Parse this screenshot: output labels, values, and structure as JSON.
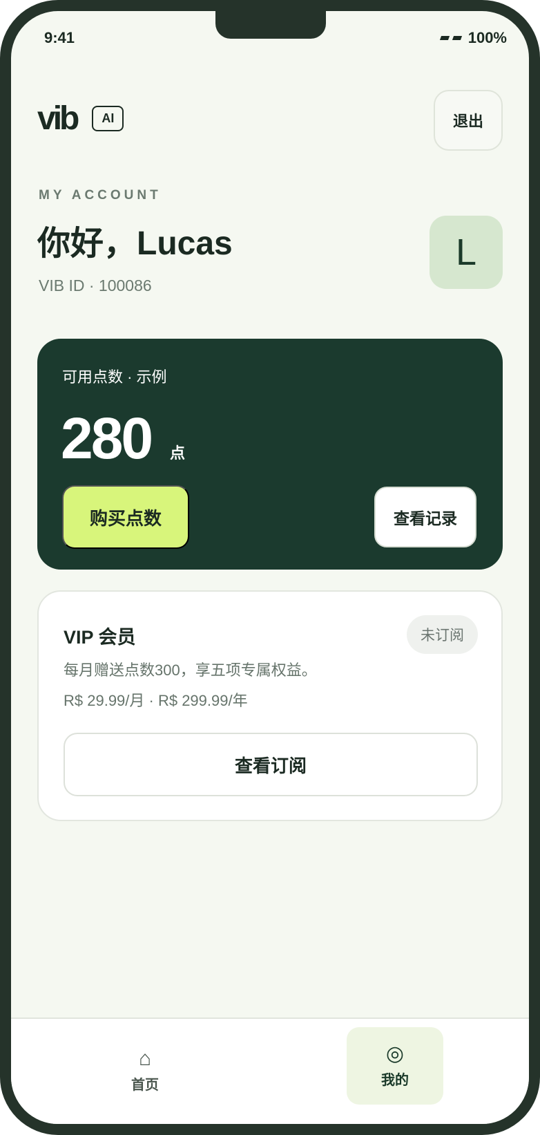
{
  "status_bar": {
    "time": "9:41",
    "battery": "100%"
  },
  "header": {
    "logo": "vib",
    "ai_badge": "AI",
    "logout_label": "退出"
  },
  "account": {
    "eyebrow": "MY ACCOUNT",
    "greeting": "你好，Lucas",
    "vib_id": "VIB ID · 100086",
    "avatar_initial": "L"
  },
  "points_card": {
    "label": "可用点数 · 示例",
    "value": "280",
    "unit": "点",
    "buy_label": "购买点数",
    "history_label": "查看记录"
  },
  "vip_card": {
    "title": "VIP 会员",
    "status": "未订阅",
    "description": "每月赠送点数300，享五项专属权益。",
    "price": "R$ 29.99/月 · R$ 299.99/年",
    "subscribe_label": "查看订阅"
  },
  "tabbar": {
    "items": [
      {
        "label": "首页",
        "icon": "home-icon"
      },
      {
        "label": "我的",
        "icon": "target-icon"
      }
    ]
  },
  "colors": {
    "background": "#f5f8f1",
    "card_dark": "#1b3a2e",
    "accent_lime": "#d8f57b",
    "avatar_bg": "#d6e7cf"
  }
}
